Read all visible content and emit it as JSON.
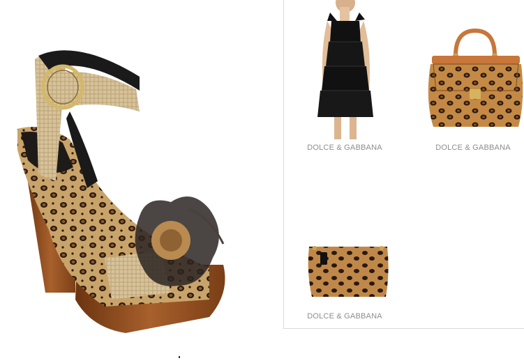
{
  "main_product": {
    "icon": "platform-sandal-image",
    "alt": ""
  },
  "related_products": [
    {
      "brand": "DOLCE & GABBANA",
      "icon": "black-dress-image"
    },
    {
      "brand": "DOLCE & GABBANA",
      "icon": "leopard-handbag-image"
    },
    {
      "brand": "DOLCE & GABBANA",
      "icon": "leopard-clutch-image"
    }
  ],
  "colors": {
    "brand_text": "#8c8c8c",
    "divider": "#d9d9d9",
    "wood": "#8a4a1e",
    "leopard_base": "#c79a5c"
  }
}
